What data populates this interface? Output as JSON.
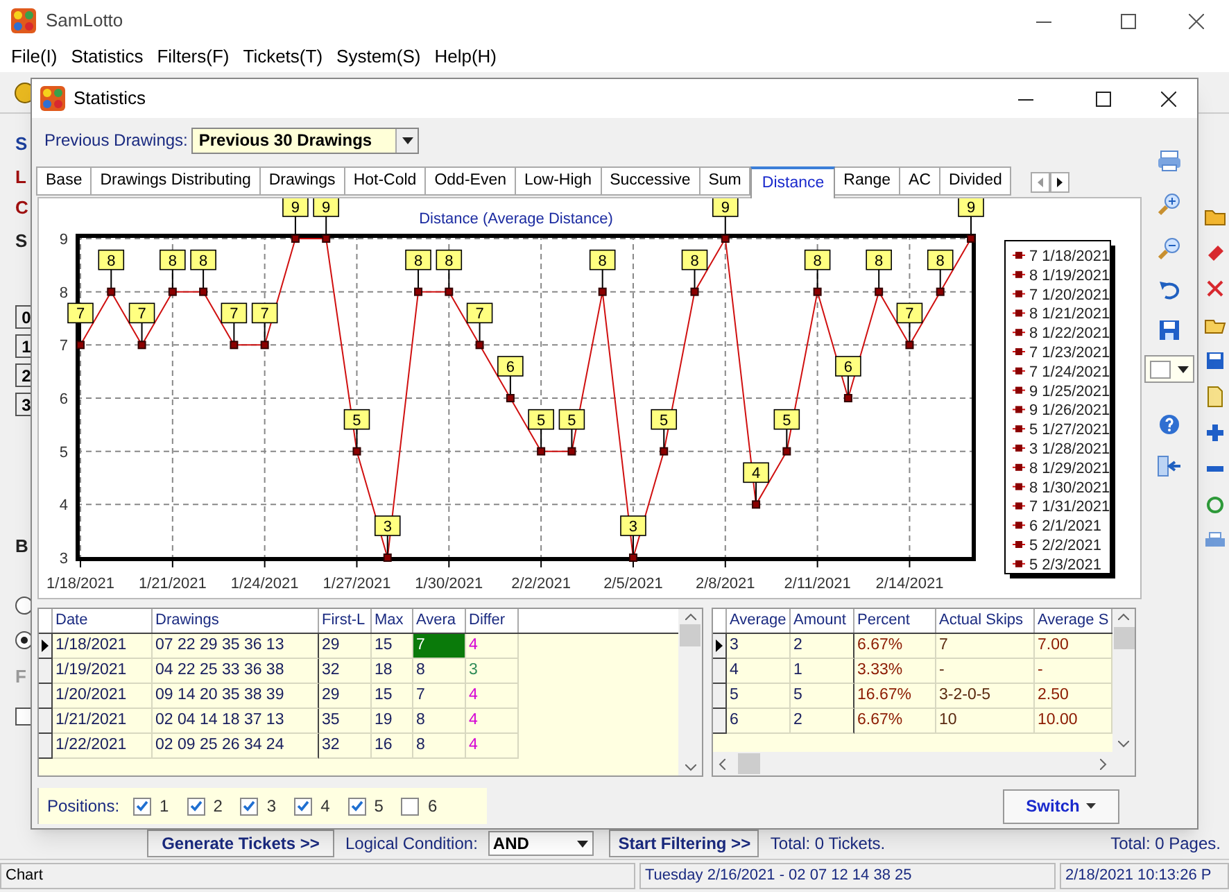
{
  "main_window": {
    "title": "SamLotto",
    "menu": [
      "File(I)",
      "Statistics",
      "Filters(F)",
      "Tickets(T)",
      "System(S)",
      "Help(H)"
    ],
    "left_fragments": [
      {
        "kind": "label",
        "text": "S",
        "color": "#1c3f9c"
      },
      {
        "kind": "label",
        "text": "L",
        "color": "#a01010"
      },
      {
        "kind": "label",
        "text": "C",
        "color": "#a01010"
      },
      {
        "kind": "label",
        "text": "S",
        "color": "#222222"
      },
      {
        "kind": "key",
        "text": "0"
      },
      {
        "kind": "key",
        "text": "1"
      },
      {
        "kind": "key",
        "text": "2"
      },
      {
        "kind": "key",
        "text": "3"
      },
      {
        "kind": "label",
        "text": "B",
        "color": "#222222"
      },
      {
        "kind": "radio",
        "selected": false
      },
      {
        "kind": "radio",
        "selected": true
      },
      {
        "kind": "label",
        "text": "F",
        "color": "#9a9a9a"
      },
      {
        "kind": "checkbox",
        "checked": false
      }
    ],
    "generate_button": "Generate Tickets >>",
    "logic_label": "Logical Condition:",
    "logic_value": "AND",
    "filter_button": "Start Filtering >>",
    "tickets_total": "Total: 0 Tickets.",
    "pages_total": "Total: 0 Pages.",
    "status_bar": [
      "Chart",
      "Tuesday 2/16/2021 - 02 07 12 14 38 25",
      "2/18/2021 10:13:26 P"
    ]
  },
  "dialog": {
    "title": "Statistics",
    "previous_label": "Previous Drawings:",
    "previous_value": "Previous 30 Drawings",
    "tabs": [
      {
        "label": "Base",
        "selected": false
      },
      {
        "label": "Drawings Distributing",
        "selected": false
      },
      {
        "label": "Drawings",
        "selected": false
      },
      {
        "label": "Hot-Cold",
        "selected": false
      },
      {
        "label": "Odd-Even",
        "selected": false
      },
      {
        "label": "Low-High",
        "selected": false
      },
      {
        "label": "Successive",
        "selected": false
      },
      {
        "label": "Sum",
        "selected": false
      },
      {
        "label": "Distance",
        "selected": true
      },
      {
        "label": "Range",
        "selected": false
      },
      {
        "label": "AC",
        "selected": false
      },
      {
        "label": "Divided",
        "selected": false
      }
    ],
    "chart": {
      "chart_data": {
        "type": "line",
        "title": "Distance (Average Distance)",
        "categories": [
          "1/18/2021",
          null,
          null,
          "1/21/2021",
          null,
          null,
          "1/24/2021",
          null,
          null,
          "1/27/2021",
          null,
          null,
          "1/30/2021",
          null,
          null,
          "2/2/2021",
          null,
          null,
          "2/5/2021",
          null,
          null,
          "2/8/2021",
          null,
          null,
          "2/11/2021",
          null,
          null,
          "2/14/2021",
          null,
          null
        ],
        "values": [
          7,
          8,
          7,
          8,
          8,
          7,
          7,
          9,
          9,
          5,
          3,
          8,
          8,
          7,
          6,
          5,
          5,
          8,
          3,
          5,
          8,
          9,
          4,
          5,
          8,
          6,
          8,
          7,
          8,
          9
        ],
        "ylim": [
          3,
          9
        ],
        "yticks": [
          3,
          4,
          5,
          6,
          7,
          8,
          9
        ],
        "grid": true,
        "marker": "square",
        "data_labels": true
      },
      "legend": [
        "7 1/18/2021",
        "8 1/19/2021",
        "7 1/20/2021",
        "8 1/21/2021",
        "8 1/22/2021",
        "7 1/23/2021",
        "7 1/24/2021",
        "9 1/25/2021",
        "9 1/26/2021",
        "5 1/27/2021",
        "3 1/28/2021",
        "8 1/29/2021",
        "8 1/30/2021",
        "7 1/31/2021",
        "6 2/1/2021",
        "5 2/2/2021",
        "5 2/3/2021"
      ]
    },
    "drawings_grid": {
      "columns": [
        "Date",
        "Drawings",
        "First-L",
        "Max",
        "Avera",
        "Differ"
      ],
      "rows": [
        {
          "selected": true,
          "average_focused": true,
          "color": "#d400d4",
          "cells": [
            "1/18/2021",
            "07 22 29 35 36 13",
            "29",
            "15",
            "7",
            "4"
          ]
        },
        {
          "selected": false,
          "average_focused": false,
          "color": "#2e8b57",
          "cells": [
            "1/19/2021",
            "04 22 25 33 36 38",
            "32",
            "18",
            "8",
            "3"
          ]
        },
        {
          "selected": false,
          "average_focused": false,
          "color": "#d400d4",
          "cells": [
            "1/20/2021",
            "09 14 20 35 38 39",
            "29",
            "15",
            "7",
            "4"
          ]
        },
        {
          "selected": false,
          "average_focused": false,
          "color": "#d400d4",
          "cells": [
            "1/21/2021",
            "02 04 14 18 37 13",
            "35",
            "19",
            "8",
            "4"
          ]
        },
        {
          "selected": false,
          "average_focused": false,
          "color": "#d400d4",
          "cells": [
            "1/22/2021",
            "02 09 25 26 34 24",
            "32",
            "16",
            "8",
            "4"
          ]
        }
      ]
    },
    "summary_grid": {
      "columns": [
        "Average",
        "Amount",
        "Percent",
        "Actual Skips",
        "Average S"
      ],
      "rows": [
        {
          "selected": true,
          "cells": [
            "3",
            "2",
            "6.67%",
            "7",
            "7.00"
          ]
        },
        {
          "selected": false,
          "cells": [
            "4",
            "1",
            "3.33%",
            "-",
            "-"
          ]
        },
        {
          "selected": false,
          "cells": [
            "5",
            "5",
            "16.67%",
            "3-2-0-5",
            "2.50"
          ]
        },
        {
          "selected": false,
          "cells": [
            "6",
            "2",
            "6.67%",
            "10",
            "10.00"
          ]
        }
      ]
    },
    "positions": {
      "label": "Positions:",
      "items": [
        {
          "label": "1",
          "checked": true
        },
        {
          "label": "2",
          "checked": true
        },
        {
          "label": "3",
          "checked": true
        },
        {
          "label": "4",
          "checked": true
        },
        {
          "label": "5",
          "checked": true
        },
        {
          "label": "6",
          "checked": false
        }
      ]
    },
    "switch_button": "Switch"
  }
}
